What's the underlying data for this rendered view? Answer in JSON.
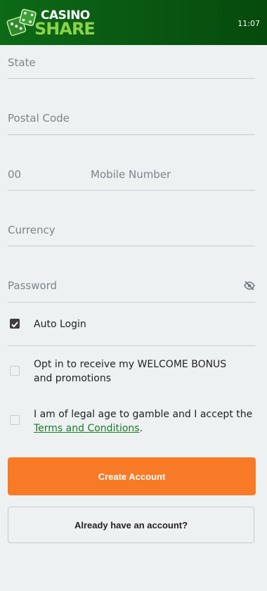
{
  "header": {
    "logo_line1": "CASINO",
    "logo_line2": "SHARE",
    "time": "11:07"
  },
  "form": {
    "state_placeholder": "State",
    "postal_code_placeholder": "Postal Code",
    "phone_prefix": "00",
    "mobile_placeholder": "Mobile Number",
    "currency_placeholder": "Currency",
    "password_placeholder": "Password",
    "password_toggle_icon": "eye-off-icon"
  },
  "options": {
    "auto_login": {
      "label": "Auto Login",
      "checked": true
    },
    "welcome_bonus": {
      "label": "Opt in to receive my WELCOME BONUS and promotions",
      "checked": false
    },
    "legal_age": {
      "text_before": "I am of legal age to gamble and I accept the ",
      "link_text": "Terms and Conditions",
      "text_after": ".",
      "checked": false
    }
  },
  "actions": {
    "create_account": "Create Account",
    "already_have_account": "Already have an account?"
  },
  "colors": {
    "header_green": "#0a5a12",
    "logo_share_green": "#8bd24a",
    "accent_orange": "#f97a26",
    "link_green": "#1c7a26",
    "background": "#edf1f2"
  }
}
